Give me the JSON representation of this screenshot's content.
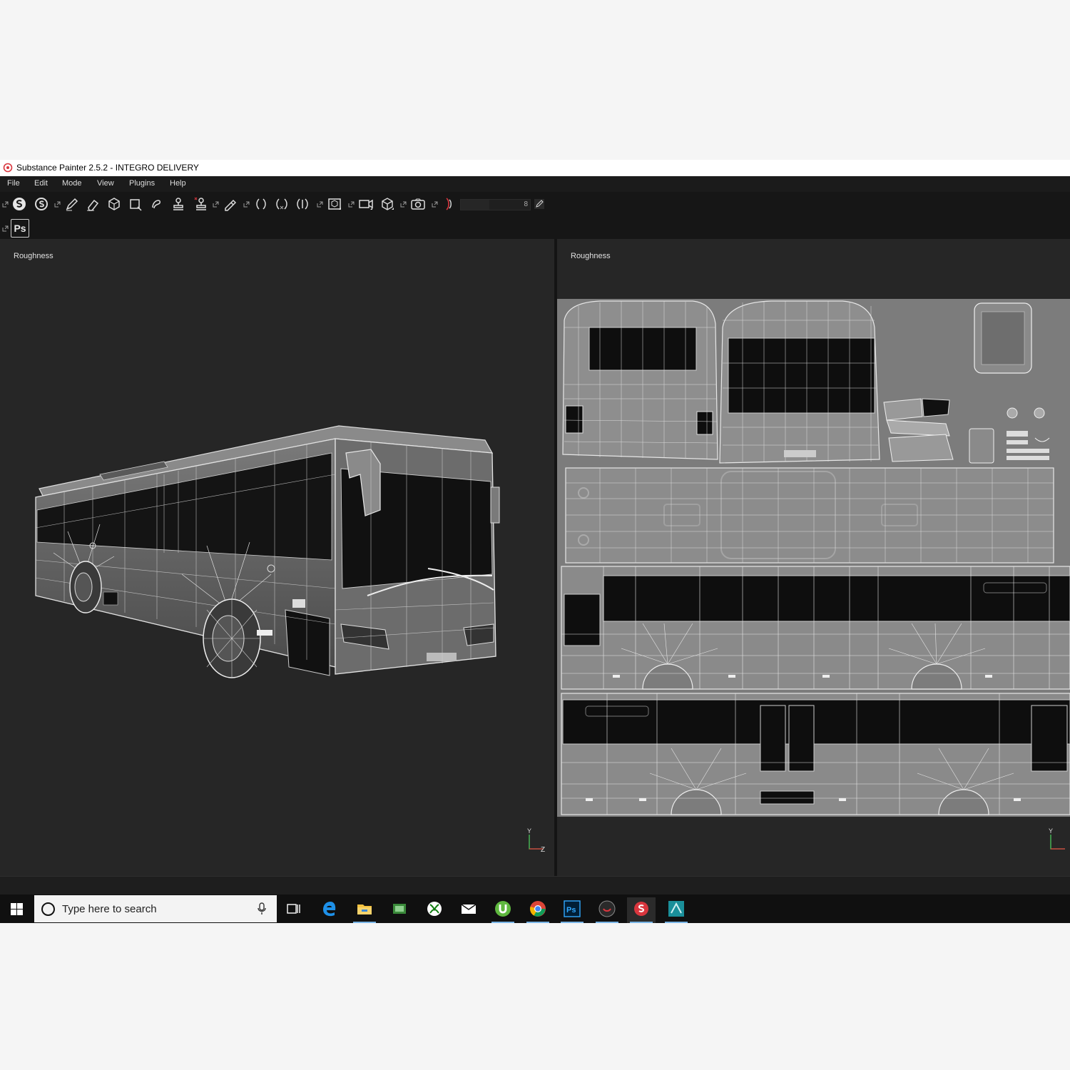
{
  "window": {
    "title": "Substance Painter 2.5.2 - INTEGRO DELIVERY"
  },
  "menu": {
    "items": [
      "File",
      "Edit",
      "Mode",
      "View",
      "Plugins",
      "Help"
    ]
  },
  "toolbar": {
    "size_value": "8",
    "ps_label": "Ps"
  },
  "viewports": {
    "left_channel": "Roughness",
    "right_channel": "Roughness",
    "axis_y": "Y",
    "axis_z": "Z"
  },
  "taskbar": {
    "search_placeholder": "Type here to search",
    "pinned_icons": [
      "task-view-icon",
      "edge-icon",
      "file-explorer-icon",
      "green-app-icon",
      "xbox-icon",
      "mail-icon",
      "utorrent-icon",
      "chrome-icon",
      "photoshop-icon",
      "dark-app-icon",
      "substance-painter-icon",
      "3dsmax-icon"
    ]
  },
  "colors": {
    "accent": "#78b4e6",
    "substance_red": "#d9363e"
  }
}
